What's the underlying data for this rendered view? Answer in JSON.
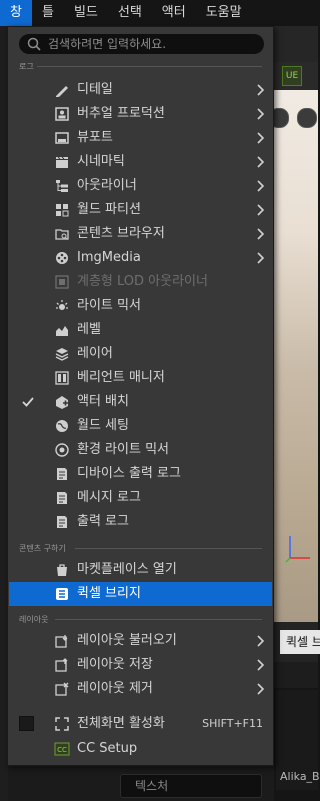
{
  "menubar": {
    "items": [
      "창",
      "틀",
      "빌드",
      "선택",
      "액터",
      "도움말"
    ]
  },
  "search": {
    "placeholder": "검색하려면 입력하세요."
  },
  "sections": {
    "log": "로그",
    "content": "콘텐츠 구하기",
    "layout": "레이아웃"
  },
  "menu_items": [
    {
      "label": "디테일",
      "icon": "pencil-icon",
      "submenu": true
    },
    {
      "label": "버추얼 프로덕션",
      "icon": "person-frame-icon",
      "submenu": true
    },
    {
      "label": "뷰포트",
      "icon": "viewport-icon",
      "submenu": true
    },
    {
      "label": "시네마틱",
      "icon": "clapper-icon",
      "submenu": true
    },
    {
      "label": "아웃라이너",
      "icon": "outliner-icon",
      "submenu": true
    },
    {
      "label": "월드 파티션",
      "icon": "grid-icon",
      "submenu": true
    },
    {
      "label": "콘텐츠 브라우저",
      "icon": "content-browser-icon",
      "submenu": true
    },
    {
      "label": "ImgMedia",
      "icon": "film-reel-icon",
      "submenu": true
    },
    {
      "label": "계층형 LOD 아웃라이너",
      "icon": "hlod-icon",
      "disabled": true
    },
    {
      "label": "라이트 믹서",
      "icon": "light-icon"
    },
    {
      "label": "레벨",
      "icon": "level-icon"
    },
    {
      "label": "레이어",
      "icon": "layers-icon"
    },
    {
      "label": "베리언트 매니저",
      "icon": "variant-icon"
    },
    {
      "label": "액터 배치",
      "icon": "place-actor-icon",
      "checked": true
    },
    {
      "label": "월드 세팅",
      "icon": "globe-icon"
    },
    {
      "label": "환경 라이트 믹서",
      "icon": "env-light-icon"
    },
    {
      "label": "디바이스 출력 로그",
      "icon": "log-icon"
    },
    {
      "label": "메시지 로그",
      "icon": "log-icon"
    },
    {
      "label": "출력 로그",
      "icon": "log-icon"
    },
    {
      "label": "마켓플레이스 열기",
      "icon": "marketplace-icon"
    },
    {
      "label": "퀵셀 브리지",
      "icon": "bridge-icon",
      "highlighted": true
    },
    {
      "label": "레이아웃 불러오기",
      "icon": "layout-load-icon",
      "submenu": true
    },
    {
      "label": "레이아웃 저장",
      "icon": "layout-save-icon",
      "submenu": true
    },
    {
      "label": "레이아웃 제거",
      "icon": "layout-remove-icon",
      "submenu": true
    },
    {
      "label": "전체화면 활성화",
      "icon": "fullscreen-icon",
      "shortcut": "SHIFT+F11",
      "checkbox": true
    },
    {
      "label": "CC Setup",
      "icon": "cc-setup-icon"
    }
  ],
  "background": {
    "panel_tab": "퀵셀 브",
    "asset_name": "Alika_B",
    "bottom_search": "텍스처",
    "ue_icon_text": "UE"
  },
  "colors": {
    "accent": "#0e6ad0",
    "menu_bg": "#383838",
    "bar_bg": "#151515"
  }
}
